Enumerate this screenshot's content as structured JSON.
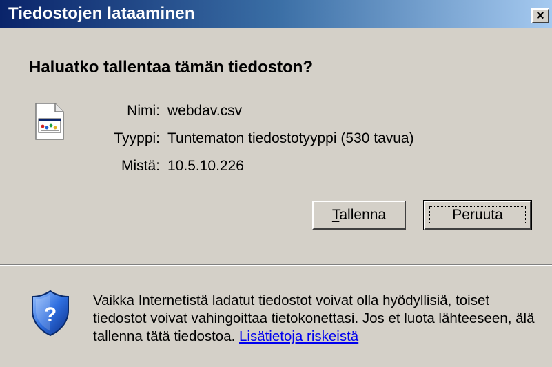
{
  "window": {
    "title": "Tiedostojen lataaminen",
    "close_glyph": "×"
  },
  "dialog": {
    "question": "Haluatko tallentaa tämän tiedoston?",
    "file_icon": "csv-file-icon",
    "fields": [
      {
        "label": "Nimi:",
        "value": "webdav.csv"
      },
      {
        "label": "Tyyppi:",
        "value": "Tuntematon tiedostotyyppi (530 tavua)"
      },
      {
        "label": "Mistä:",
        "value": "10.5.10.226"
      }
    ],
    "buttons": {
      "save_mnemonic": "T",
      "save_rest": "allenna",
      "cancel_label": "Peruuta"
    }
  },
  "warning": {
    "icon": "security-shield-icon",
    "text": "Vaikka Internetistä ladatut tiedostot voivat olla hyödyllisiä, toiset tiedostot voivat vahingoittaa tietokonettasi. Jos et luota lähteeseen, älä tallenna tätä tiedostoa.",
    "link_text": "Lisätietoja riskeistä"
  },
  "colors": {
    "face": "#d4d0c8",
    "titlebar_start": "#0a246a",
    "titlebar_end": "#a6caf0",
    "link": "#0000ee"
  }
}
